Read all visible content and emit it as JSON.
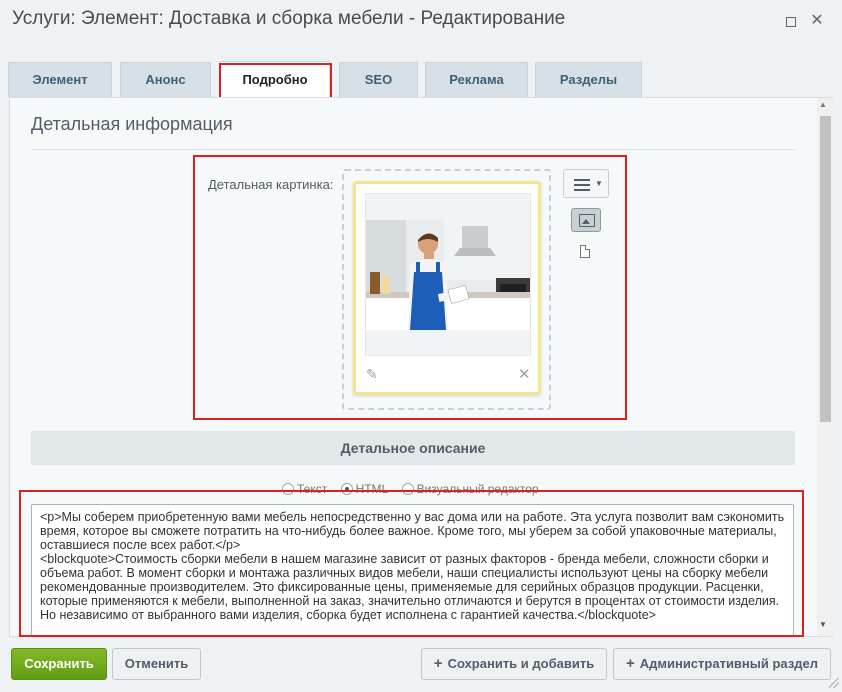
{
  "window": {
    "title": "Услуги: Элемент: Доставка и сборка мебели - Редактирование",
    "maximize_icon": "maximize-icon",
    "close_label": "✕"
  },
  "tabs": [
    {
      "label": "Элемент",
      "active": false
    },
    {
      "label": "Анонс",
      "active": false
    },
    {
      "label": "Подробно",
      "active": true
    },
    {
      "label": "SEO",
      "active": false
    },
    {
      "label": "Реклама",
      "active": false
    },
    {
      "label": "Разделы",
      "active": false
    }
  ],
  "main": {
    "section_title": "Детальная информация",
    "picture_label": "Детальная картинка:",
    "description_header": "Детальное описание",
    "editor_modes": [
      {
        "label": "Текст",
        "selected": false
      },
      {
        "label": "HTML",
        "selected": true
      },
      {
        "label": "Визуальный редактор",
        "selected": false
      }
    ],
    "editor_text": "<p>Мы соберем приобретенную вами мебель непосредственно у вас дома или на работе. Эта услуга позволит вам сэкономить время, которое вы сможете потратить на что-нибудь более важное. Кроме того, мы уберем за собой упаковочные материалы, оставшиеся после всех работ.</p>\n<blockquote>Стоимость сборки мебели в нашем магазине зависит от разных факторов - бренда мебели, сложности сборки и объема работ. В момент сборки и монтажа различных видов мебели, наши специалисты используют цены на сборку мебели рекомендованные производителем. Это фиксированные цены, применяемые для серийных образцов продукции. Расценки, которые применяются к мебели, выполненной на заказ, значительно отличаются и берутся в процентах от стоимости изделия. Но независимо от выбранного вами изделия, сборка будет исполнена с гарантией качества.</blockquote>"
  },
  "footer": {
    "save_label": "Сохранить",
    "cancel_label": "Отменить",
    "save_add_label": "Сохранить и добавить",
    "admin_label": "Административный раздел"
  },
  "colors": {
    "highlight": "#e02020",
    "save_button": "#72aa1e",
    "tab_text": "#3f6076"
  }
}
